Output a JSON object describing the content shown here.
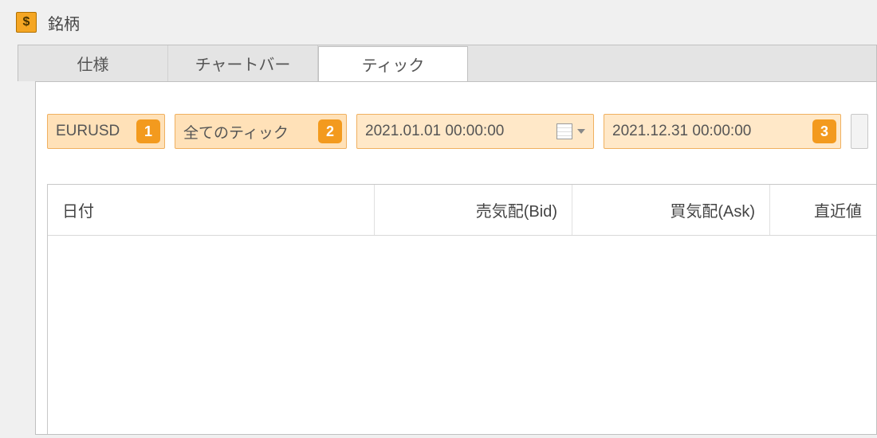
{
  "window": {
    "title": "銘柄"
  },
  "tabs": [
    {
      "label": "仕様",
      "active": false
    },
    {
      "label": "チャートバー",
      "active": false
    },
    {
      "label": "ティック",
      "active": true
    }
  ],
  "toolbar": {
    "symbol": "EURUSD",
    "tick_type": "全てのティック",
    "date_from": "2021.01.01 00:00:00",
    "date_to": "2021.12.31 00:00:00",
    "callouts": {
      "symbol": "1",
      "tick_type": "2",
      "date_to": "3"
    }
  },
  "table": {
    "columns": [
      "日付",
      "売気配(Bid)",
      "買気配(Ask)",
      "直近値"
    ],
    "rows": []
  }
}
